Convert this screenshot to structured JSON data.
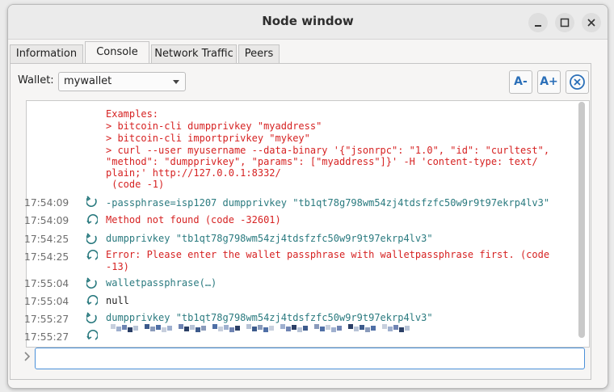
{
  "window": {
    "title": "Node window"
  },
  "tabs": [
    {
      "label": "Information",
      "active": false
    },
    {
      "label": "Console",
      "active": true
    },
    {
      "label": "Network Traffic",
      "active": false
    },
    {
      "label": "Peers",
      "active": false
    }
  ],
  "wallet": {
    "label": "Wallet:",
    "selected": "mywallet"
  },
  "toolbar": {
    "font_smaller": "A-",
    "font_larger": "A+"
  },
  "console": {
    "help": [
      "Examples:",
      "> bitcoin-cli dumpprivkey \"myaddress\"",
      "> bitcoin-cli importprivkey \"mykey\"",
      "> curl --user myusername --data-binary '{\"jsonrpc\": \"1.0\", \"id\": \"curltest\",",
      "\"method\": \"dumpprivkey\", \"params\": [\"myaddress\"]}' -H 'content-type: text/",
      "plain;' http://127.0.0.1:8332/",
      " (code -1)"
    ],
    "entries": [
      {
        "time": "17:54:09",
        "kind": "command",
        "text": "-passphrase=isp1207 dumpprivkey \"tb1qt78g798wm54zj4tdsfzfc50w9r9t97ekrp4lv3\""
      },
      {
        "time": "17:54:09",
        "kind": "error",
        "text": "Method not found (code -32601)"
      },
      {
        "time": "17:54:25",
        "kind": "command",
        "text": "dumpprivkey \"tb1qt78g798wm54zj4tdsfzfc50w9r9t97ekrp4lv3\""
      },
      {
        "time": "17:54:25",
        "kind": "error",
        "text": "Error: Please enter the wallet passphrase with walletpassphrase first. (code\n-13)"
      },
      {
        "time": "17:55:04",
        "kind": "command",
        "text": "walletpassphrase(…)"
      },
      {
        "time": "17:55:04",
        "kind": "reply",
        "text": "null"
      },
      {
        "time": "17:55:27",
        "kind": "command",
        "text": "dumpprivkey \"tb1qt78g798wm54zj4tdsfzfc50w9r9t97ekrp4lv3\""
      },
      {
        "time": "17:55:27",
        "kind": "reply_redacted",
        "text": ""
      }
    ]
  },
  "input": {
    "value": ""
  },
  "colors": {
    "error": "#d62222",
    "command": "#2a7a7f",
    "accent": "#2a6fb8",
    "focus": "#4a90d9"
  },
  "icons": {
    "command": "command-sent-icon",
    "reply": "reply-received-icon",
    "clear": "clear-console-icon",
    "prompt": "prompt-chevron-icon"
  }
}
